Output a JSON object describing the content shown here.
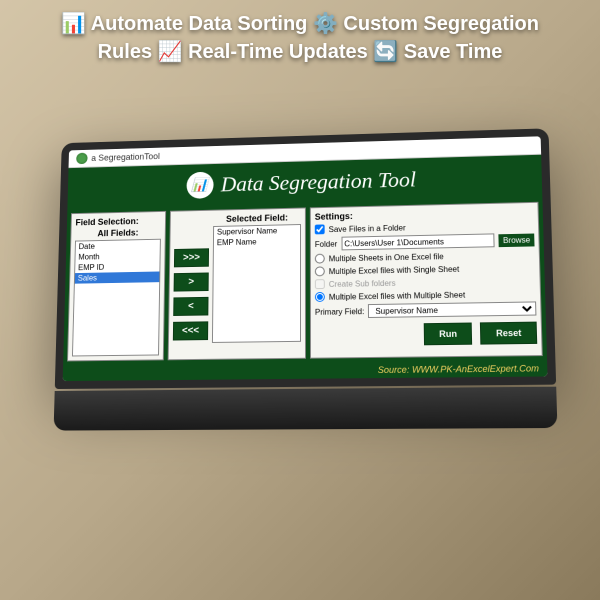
{
  "overlay": {
    "line1": "📊 Automate Data Sorting ⚙️ Custom Segregation",
    "line2": "Rules 📈 Real-Time Updates 🔄 Save Time"
  },
  "window": {
    "title": "a SegregationTool"
  },
  "header": {
    "title": "Data Segregation Tool"
  },
  "fieldSelection": {
    "label": "Field Selection:",
    "allFieldsLabel": "All Fields:",
    "allFields": [
      "Date",
      "Month",
      "EMP ID",
      "Sales"
    ],
    "selectedLabel": "Selected Field:",
    "selectedFields": [
      "Supervisor Name",
      "EMP Name"
    ]
  },
  "arrows": {
    "addAll": ">>>",
    "add": ">",
    "remove": "<",
    "removeAll": "<<<"
  },
  "settings": {
    "label": "Settings:",
    "saveFolderLabel": "Save Files in a Folder",
    "saveFolderChecked": true,
    "folderLabel": "Folder",
    "folderPath": "C:\\Users\\User 1\\Documents",
    "browseLabel": "Browse",
    "opt1": "Multiple Sheets in One Excel file",
    "opt2": "Multiple Excel files with Single Sheet",
    "subfoldersLabel": "Create Sub folders",
    "opt3": "Multiple Excel files with Multiple Sheet",
    "primaryFieldLabel": "Primary Field:",
    "primaryFieldValue": "Supervisor Name"
  },
  "actions": {
    "run": "Run",
    "reset": "Reset"
  },
  "footer": {
    "source": "Source: WWW.PK-AnExcelExpert.Com"
  }
}
